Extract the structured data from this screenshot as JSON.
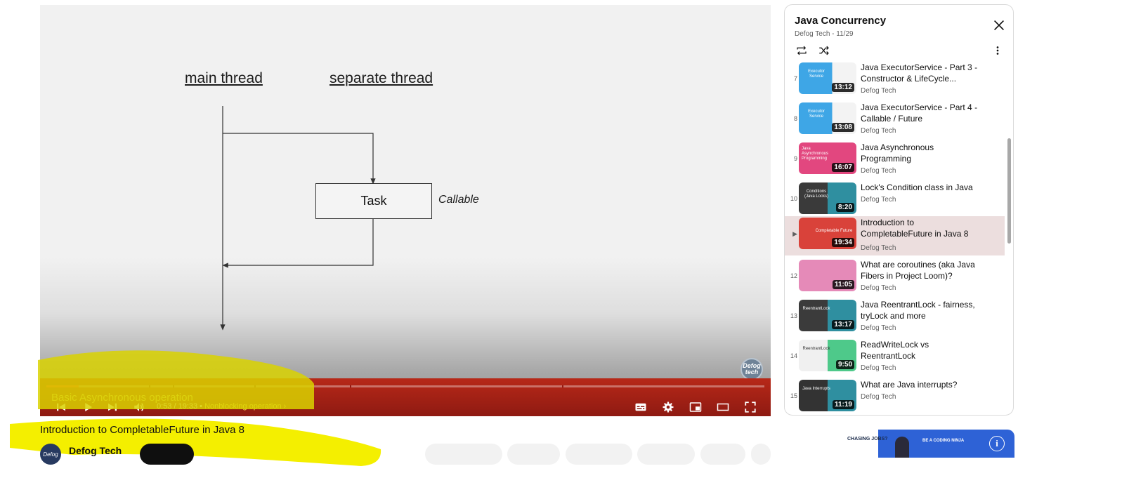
{
  "player": {
    "slide": {
      "main_thread_label": "main thread",
      "separate_thread_label": "separate thread",
      "task_label": "Task",
      "callable_label": "Callable",
      "watermark": "Defog tech"
    },
    "chapter_overlay": "Basic Asynchronous operation",
    "progress_fraction": 0.045,
    "time_current": "0:53",
    "time_separator": " / ",
    "time_total": "19:33",
    "chapter_sep": " • ",
    "chapter_name": "Nonblocking operation",
    "chapter_arrow": "›",
    "icons": [
      "previous-icon",
      "play-icon",
      "next-icon",
      "volume-icon",
      "subtitles-icon",
      "settings-icon",
      "miniplayer-icon",
      "theater-mode-icon",
      "fullscreen-icon"
    ]
  },
  "video": {
    "title": "Introduction to CompletableFuture in Java 8",
    "channel": "Defog Tech",
    "avatar_text": "Defog"
  },
  "playlist": {
    "title": "Java Concurrency",
    "subtitle": "Defog Tech - 11/29",
    "items": [
      {
        "index": "7",
        "title": "Java ExecutorService - Part 3 - Constructor & LifeCycle...",
        "channel": "Defog Tech",
        "duration": "13:12",
        "thumb_text": "Executor Service",
        "thumb_color": "#3ea6e6",
        "active": false
      },
      {
        "index": "8",
        "title": "Java ExecutorService - Part 4 - Callable / Future",
        "channel": "Defog Tech",
        "duration": "13:08",
        "thumb_text": "Executor Service",
        "thumb_color": "#3ea6e6",
        "active": false
      },
      {
        "index": "9",
        "title": "Java Asynchronous Programming",
        "channel": "Defog Tech",
        "duration": "16:07",
        "thumb_text": "Java Asynchronous Programming",
        "thumb_color": "#e2477f",
        "active": false
      },
      {
        "index": "10",
        "title": "Lock's Condition class in Java",
        "channel": "Defog Tech",
        "duration": "8:20",
        "thumb_text": "Conditions (Java Locks)",
        "thumb_color": "#3a3a3a",
        "active": false
      },
      {
        "index": "▶",
        "title": "Introduction to CompletableFuture in Java 8",
        "channel": "Defog Tech",
        "duration": "19:34",
        "thumb_text": "Completable Future",
        "thumb_color": "#d9423a",
        "active": true
      },
      {
        "index": "12",
        "title": "What are coroutines (aka Java Fibers in Project Loom)?",
        "channel": "Defog Tech",
        "duration": "11:05",
        "thumb_text": "",
        "thumb_color": "#e58ab8",
        "active": false
      },
      {
        "index": "13",
        "title": "Java ReentrantLock - fairness, tryLock and more",
        "channel": "Defog Tech",
        "duration": "13:17",
        "thumb_text": "ReentrantLock",
        "thumb_color": "#3b3b3b",
        "active": false
      },
      {
        "index": "14",
        "title": "ReadWriteLock vs ReentrantLock",
        "channel": "Defog Tech",
        "duration": "9:50",
        "thumb_text": "ReentrantLock",
        "thumb_color": "#f0f0f0",
        "active": false
      },
      {
        "index": "15",
        "title": "What are Java interrupts?",
        "channel": "Defog Tech",
        "duration": "11:19",
        "thumb_text": "Java Interrupts",
        "thumb_color": "#333333",
        "active": false
      }
    ]
  },
  "ad": {
    "headline": "CHASING JOBS?",
    "tagline": "BE A CODING NINJA",
    "info_icon": "i"
  }
}
